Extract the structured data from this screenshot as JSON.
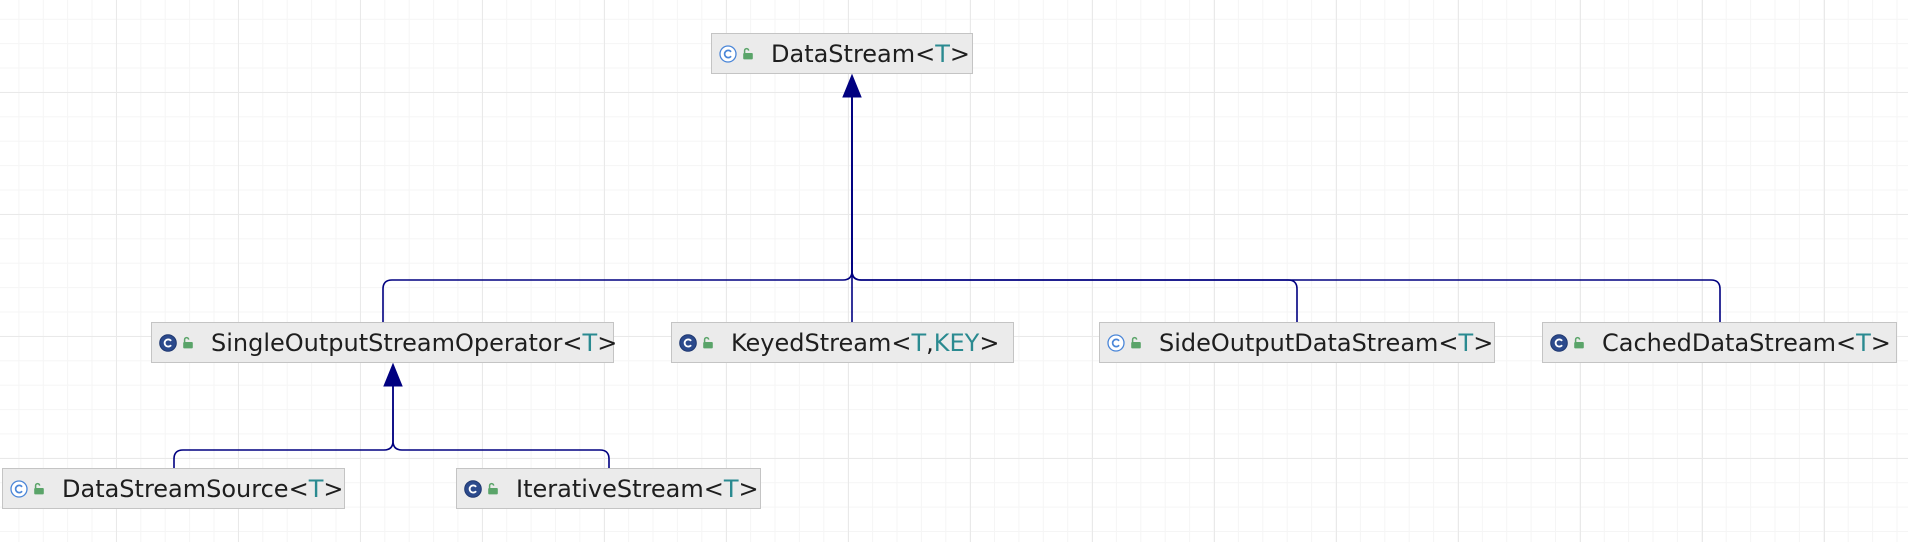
{
  "diagram": {
    "edge_color": "#000080",
    "type_param_color": "#2a8a90",
    "nodes": [
      {
        "id": "datastream",
        "base": "DataStream",
        "params": [
          "T"
        ],
        "icon": "class-icon",
        "icon_style": "outline",
        "access": "public"
      },
      {
        "id": "singleoutput",
        "base": "SingleOutputStreamOperator",
        "params": [
          "T"
        ],
        "icon": "class-icon",
        "icon_style": "filled",
        "access": "public"
      },
      {
        "id": "keyed",
        "base": "KeyedStream",
        "params": [
          "T",
          "KEY"
        ],
        "icon": "class-icon",
        "icon_style": "filled",
        "access": "public"
      },
      {
        "id": "sideoutput",
        "base": "SideOutputDataStream",
        "params": [
          "T"
        ],
        "icon": "class-icon",
        "icon_style": "outline",
        "access": "public"
      },
      {
        "id": "cached",
        "base": "CachedDataStream",
        "params": [
          "T"
        ],
        "icon": "class-icon",
        "icon_style": "filled",
        "access": "public"
      },
      {
        "id": "source",
        "base": "DataStreamSource",
        "params": [
          "T"
        ],
        "icon": "class-icon",
        "icon_style": "outline",
        "access": "public"
      },
      {
        "id": "iterative",
        "base": "IterativeStream",
        "params": [
          "T"
        ],
        "icon": "class-icon",
        "icon_style": "filled",
        "access": "public"
      }
    ],
    "edges": [
      {
        "from": "singleoutput",
        "to": "datastream",
        "relation": "extends"
      },
      {
        "from": "keyed",
        "to": "datastream",
        "relation": "extends"
      },
      {
        "from": "sideoutput",
        "to": "datastream",
        "relation": "extends"
      },
      {
        "from": "cached",
        "to": "datastream",
        "relation": "extends"
      },
      {
        "from": "source",
        "to": "singleoutput",
        "relation": "extends"
      },
      {
        "from": "iterative",
        "to": "singleoutput",
        "relation": "extends"
      }
    ]
  }
}
